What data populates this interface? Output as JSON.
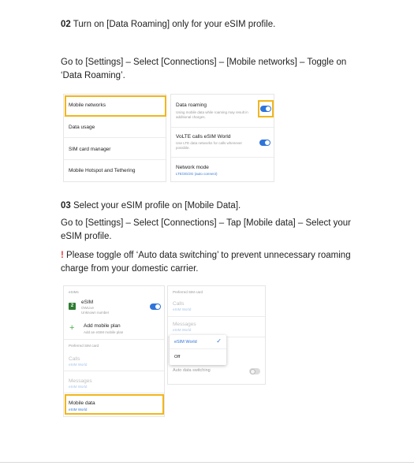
{
  "step02": {
    "number": "02",
    "heading": " Turn on [Data Roaming] only for your eSIM profile.",
    "instruction": "Go to [Settings] – Select [Connections] – [Mobile networks] – Toggle on ‘Data Roaming’."
  },
  "screen1_left": {
    "items": [
      "Mobile networks",
      "Data usage",
      "SIM card manager",
      "Mobile Hotspot and Tethering"
    ]
  },
  "screen1_right": {
    "data_roaming_title": "Data roaming",
    "data_roaming_sub": "Using mobile data while roaming may result in additional charges.",
    "volte_title": "VoLTE calls eSIM World",
    "volte_sub": "Use LTE data networks for calls whenever possible.",
    "network_mode_title": "Network mode",
    "network_mode_sub": "LTE/3G/2G (auto connect)"
  },
  "step03": {
    "number": "03",
    "heading": " Select your eSIM profile on [Mobile Data].",
    "instruction": "Go to [Settings] – Select [Connections] – Tap [Mobile data] – Select your eSIM profile.",
    "warning_mark": "!",
    "warning": " Please toggle off ‘Auto data switching’ to prevent unnecessary roaming charge from your domestic carrier."
  },
  "screen2_left": {
    "esims_header": "eSIMs",
    "esim_name": "eSIM",
    "esim_carrier": "OWLive",
    "esim_number": "Unknown number",
    "add_plan": "Add mobile plan",
    "add_plan_sub": "Add an eSIM mobile plan",
    "preferred_header": "Preferred SIM card",
    "calls_label": "Calls",
    "calls_value": "eSIM World",
    "messages_label": "Messages",
    "messages_value": "eSIM World",
    "mobile_data_label": "Mobile data",
    "mobile_data_value": "eSIM World"
  },
  "screen2_right": {
    "preferred_header": "Preferred SIM card",
    "calls_label": "Calls",
    "calls_value": "eSIM World",
    "messages_label": "Messages",
    "messages_value": "eSIM World",
    "popup_option_selected": "eSIM World",
    "popup_option_off": "Off",
    "auto_switch_label": "Auto data switching"
  },
  "colors": {
    "highlight": "#f2b61c",
    "toggle_on": "#2f74d9",
    "warning": "#e53935"
  }
}
